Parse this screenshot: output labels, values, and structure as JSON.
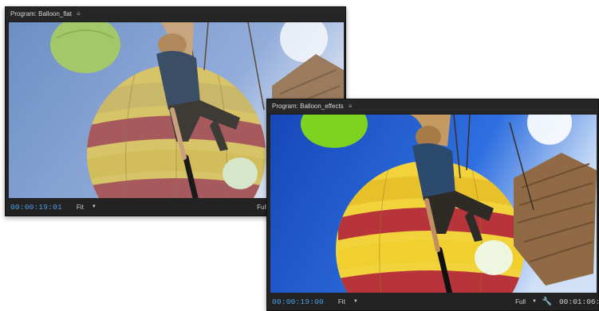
{
  "monitor_flat": {
    "title": "Program: Balloon_flat",
    "menu_icon": "panel-menu-icon",
    "timecode": "00:00:19:01",
    "zoom_label": "Fit",
    "resolution_label": "Full"
  },
  "monitor_effects": {
    "title": "Program: Balloon_effects",
    "menu_icon": "panel-menu-icon",
    "timecode": "00:00:19:00",
    "zoom_label": "Fit",
    "resolution_label": "Full",
    "settings_icon": "wrench-icon",
    "duration_timecode": "00:01:06:1"
  },
  "colors": {
    "panel_bg": "#232323",
    "timecode_blue": "#4a9ee8",
    "sky_flat": "#7b9bc9",
    "sky_effects": "#1f5bd0"
  }
}
